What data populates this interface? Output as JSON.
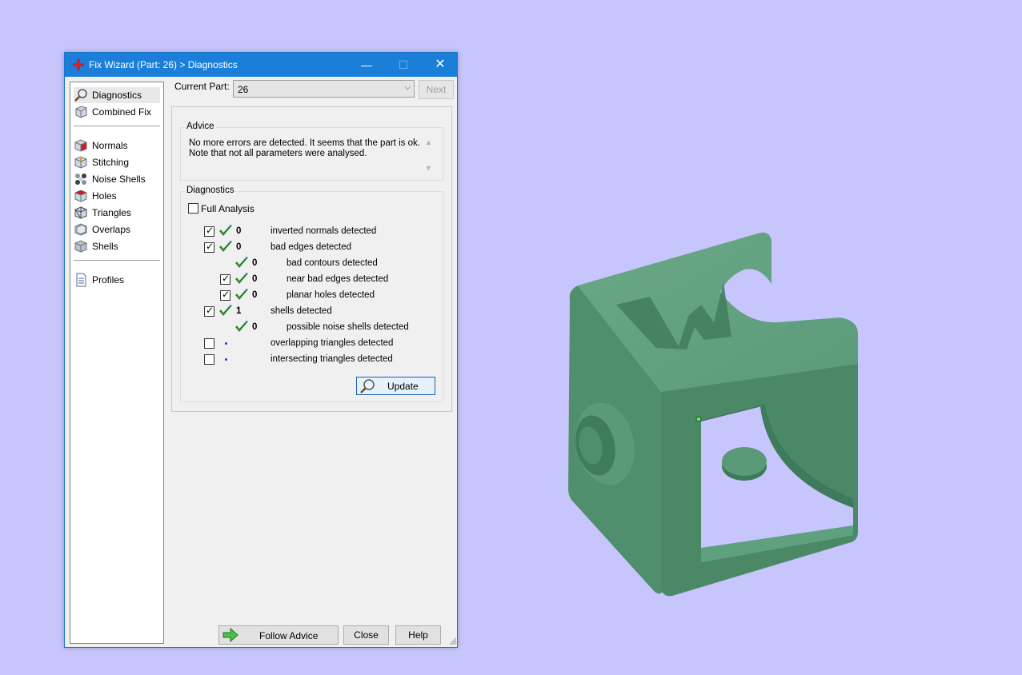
{
  "window": {
    "title": "Fix Wizard (Part: 26) > Diagnostics",
    "controls": {
      "minimize": "—",
      "maximize": "☐",
      "close": "✕"
    }
  },
  "nav": {
    "top_items": [
      {
        "label": "Diagnostics",
        "icon": "magnifier-icon",
        "selected": true
      },
      {
        "label": "Combined Fix",
        "icon": "cube-stack-icon"
      }
    ],
    "fix_items": [
      {
        "label": "Normals",
        "icon": "normals-cube-icon"
      },
      {
        "label": "Stitching",
        "icon": "stitching-cube-icon"
      },
      {
        "label": "Noise Shells",
        "icon": "noise-shells-icon"
      },
      {
        "label": "Holes",
        "icon": "holes-cube-icon"
      },
      {
        "label": "Triangles",
        "icon": "triangles-cube-icon"
      },
      {
        "label": "Overlaps",
        "icon": "overlaps-cube-icon"
      },
      {
        "label": "Shells",
        "icon": "shells-cube-icon"
      }
    ],
    "bottom_items": [
      {
        "label": "Profiles",
        "icon": "document-icon"
      }
    ]
  },
  "part": {
    "label": "Current Part:",
    "value": "26",
    "next_label": "Next"
  },
  "advice": {
    "title": "Advice",
    "lines": [
      "No more errors are detected. It seems that the part is ok.",
      "Note that not all parameters were analysed."
    ]
  },
  "diagnostics": {
    "title": "Diagnostics",
    "full_analysis_label": "Full Analysis",
    "full_analysis_checked": false,
    "rows": [
      {
        "checkbox": true,
        "checked": true,
        "status": "ok",
        "count": "0",
        "label": "inverted normals detected",
        "indent": 0
      },
      {
        "checkbox": true,
        "checked": true,
        "status": "ok",
        "count": "0",
        "label": "bad edges detected",
        "indent": 0
      },
      {
        "checkbox": false,
        "checked": false,
        "status": "ok",
        "count": "0",
        "label": "bad contours detected",
        "indent": 1
      },
      {
        "checkbox": true,
        "checked": true,
        "status": "ok",
        "count": "0",
        "label": "near bad edges detected",
        "indent": 1
      },
      {
        "checkbox": true,
        "checked": true,
        "status": "ok",
        "count": "0",
        "label": "planar holes detected",
        "indent": 1
      },
      {
        "checkbox": true,
        "checked": true,
        "status": "ok",
        "count": "1",
        "label": "shells detected",
        "indent": 0
      },
      {
        "checkbox": false,
        "checked": false,
        "status": "ok",
        "count": "0",
        "label": "possible noise shells detected",
        "indent": 1
      },
      {
        "checkbox": true,
        "checked": false,
        "status": "pending",
        "count": "",
        "label": "overlapping triangles detected",
        "indent": 0
      },
      {
        "checkbox": true,
        "checked": false,
        "status": "pending",
        "count": "",
        "label": "intersecting triangles detected",
        "indent": 0
      }
    ],
    "update_label": "Update"
  },
  "footer": {
    "follow_advice_label": "Follow Advice",
    "close_label": "Close",
    "help_label": "Help"
  },
  "colors": {
    "desktop": "#c6c6fc",
    "titlebar": "#1b7fd9",
    "model_green": "#4e8e6c",
    "check_green": "#2e8b3a"
  }
}
